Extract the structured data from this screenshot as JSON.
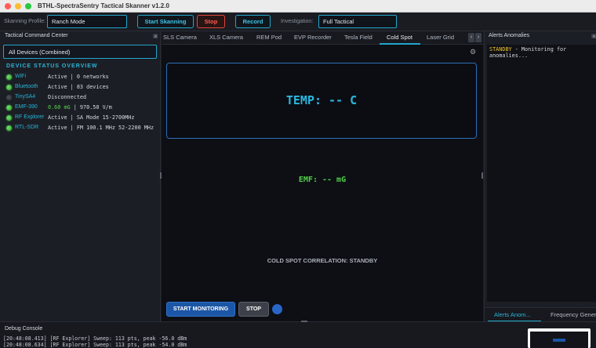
{
  "window": {
    "title": "BTHL-SpectraSentry Tactical Skanner v1.2.0"
  },
  "toolbar": {
    "profile_label": "Skanning Profile:",
    "profile_value": "Ranch Mode",
    "start_label": "Start Skanning",
    "stop_label": "Stop",
    "record_label": "Record",
    "investigation_label": "Investigation:",
    "investigation_value": "Full Tactical"
  },
  "left_panel": {
    "header": "Tactical Command Center",
    "device_select": "All Devices (Combined)",
    "overview_title": "DEVICE STATUS OVERVIEW",
    "devices": [
      {
        "name": "WiFi",
        "status": "Active | 0 networks",
        "active": true
      },
      {
        "name": "Bluetooth",
        "status": "Active | 83 devices",
        "active": true
      },
      {
        "name": "TinySA4",
        "status": "Disconnected",
        "active": false
      },
      {
        "name": "EMF-390",
        "status_value": "0.60 mG",
        "status_rest": " | 970.50 V/m",
        "active": true
      },
      {
        "name": "RF Explorer",
        "status": "Active | SA Mode  15-2700MHz",
        "active": true
      },
      {
        "name": "RTL-SDR",
        "status": "Active | FM 100.1 MHz  52-2200 MHz",
        "active": true
      }
    ]
  },
  "center": {
    "tabs": [
      "SLS Camera",
      "XLS Camera",
      "REM Pod",
      "EVP Recorder",
      "Tesla Field",
      "Cold Spot",
      "Laser Grid"
    ],
    "active_tab": "Cold Spot",
    "temp_display": "TEMP: -- C",
    "emf_display": "EMF: -- mG",
    "correlation": "COLD SPOT CORRELATION: STANDBY",
    "start_button": "START MONITORING",
    "stop_button": "STOP"
  },
  "right_panel": {
    "header": "Alerts  Anomalies",
    "alert_prefix": "STANDBY",
    "alert_message": " - Monitoring for anomalies...",
    "tabs": [
      "Alerts  Anom...",
      "Frequency Gener..."
    ]
  },
  "debug": {
    "title": "Debug Console",
    "lines": [
      "[20:48:08.413] [RF Explorer] Sweep: 113 pts, peak -56.0 dBm",
      "[20:48:08.634] [RF Explorer] Sweep: 113 pts, peak -54.0 dBm"
    ]
  },
  "colors": {
    "accent": "#22a6c9",
    "active_green": "#4fcf46",
    "alert_yellow": "#f0c229",
    "stop_red": "#e0463c",
    "primary_blue": "#1c56a6"
  }
}
